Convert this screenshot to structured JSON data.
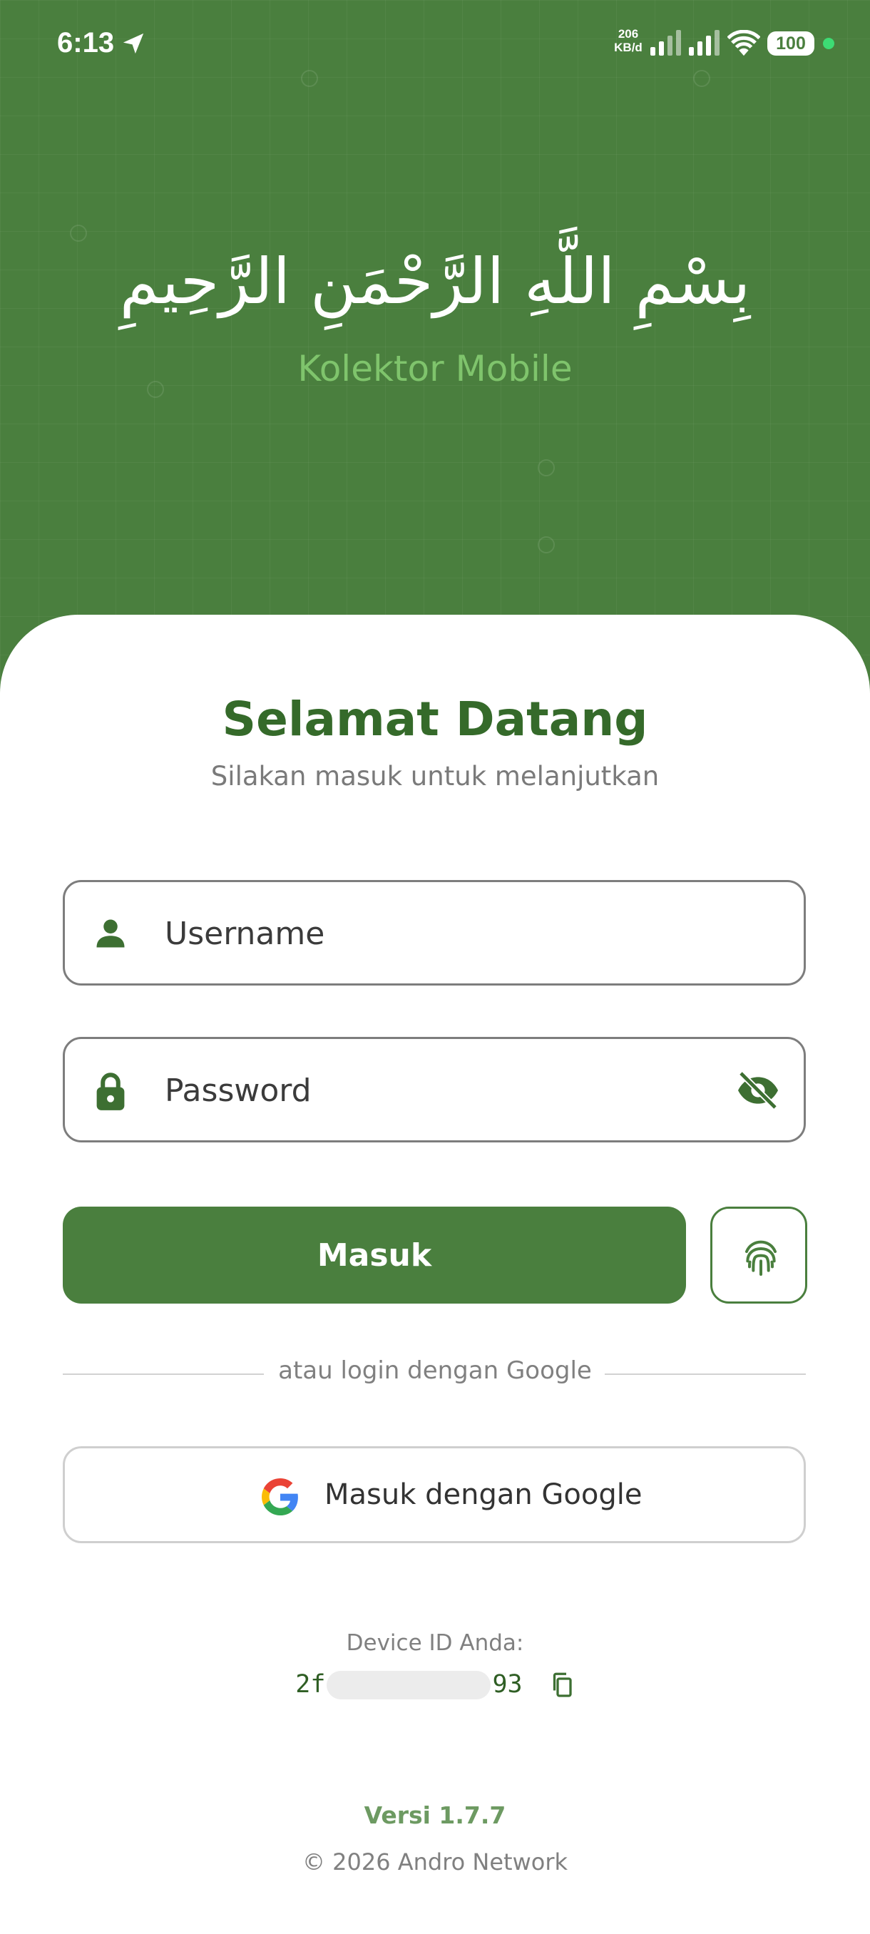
{
  "status_bar": {
    "time": "6:13",
    "net_speed_value": "206",
    "net_speed_unit": "KB/d",
    "battery": "100"
  },
  "header": {
    "bismillah": "بِسْمِ اللَّهِ الرَّحْمَنِ الرَّحِيمِ",
    "app_name": "Kolektor Mobile"
  },
  "login": {
    "title": "Selamat Datang",
    "subtitle": "Silakan masuk untuk melanjutkan",
    "username_placeholder": "Username",
    "password_placeholder": "Password",
    "submit_label": "Masuk",
    "divider_text": "atau login dengan Google",
    "google_label": "Masuk dengan Google"
  },
  "device": {
    "label": "Device ID Anda:",
    "id_prefix": "2f",
    "id_suffix": "93"
  },
  "footer": {
    "version": "Versi 1.7.7",
    "copyright": "© 2026 Andro Network"
  },
  "colors": {
    "primary": "#4a7f3e",
    "title_green": "#356a2a",
    "accent_green": "#7fc46c"
  }
}
